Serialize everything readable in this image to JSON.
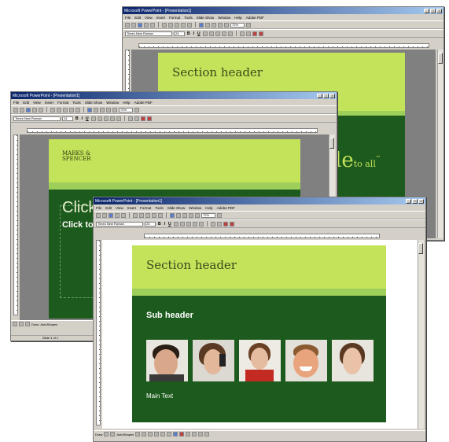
{
  "app": {
    "title": "Microsoft PowerPoint - [Presentation1]",
    "menu": [
      "File",
      "Edit",
      "View",
      "Insert",
      "Format",
      "Tools",
      "Slide Show",
      "Window",
      "Help",
      "Adobe PDF"
    ],
    "font_name": "Times New Roman",
    "font_size": "24",
    "zoom": "72%",
    "draw_label": "Draw",
    "autoshapes_label": "AutoShapes",
    "status_text": "Slide 1 of 1",
    "win_controls": [
      "_",
      "□",
      "×"
    ]
  },
  "back_window": {
    "section_header": "Section header",
    "partial_text": "le",
    "partial_small": "to all",
    "partial_mark": "™"
  },
  "middle_window": {
    "logo_line1": "MARKS &",
    "logo_line2": "SPENCER",
    "title_partial": "Click",
    "subtitle_partial": "Click to"
  },
  "front_window": {
    "section_header": "Section header",
    "sub_header": "Sub header",
    "main_text": "Main Text"
  },
  "colors": {
    "slide_green": "#1d5a1d",
    "header_lime": "#c3e35b",
    "accent_band": "#9ecf5a",
    "titlebar_navy": "#0a246a"
  }
}
